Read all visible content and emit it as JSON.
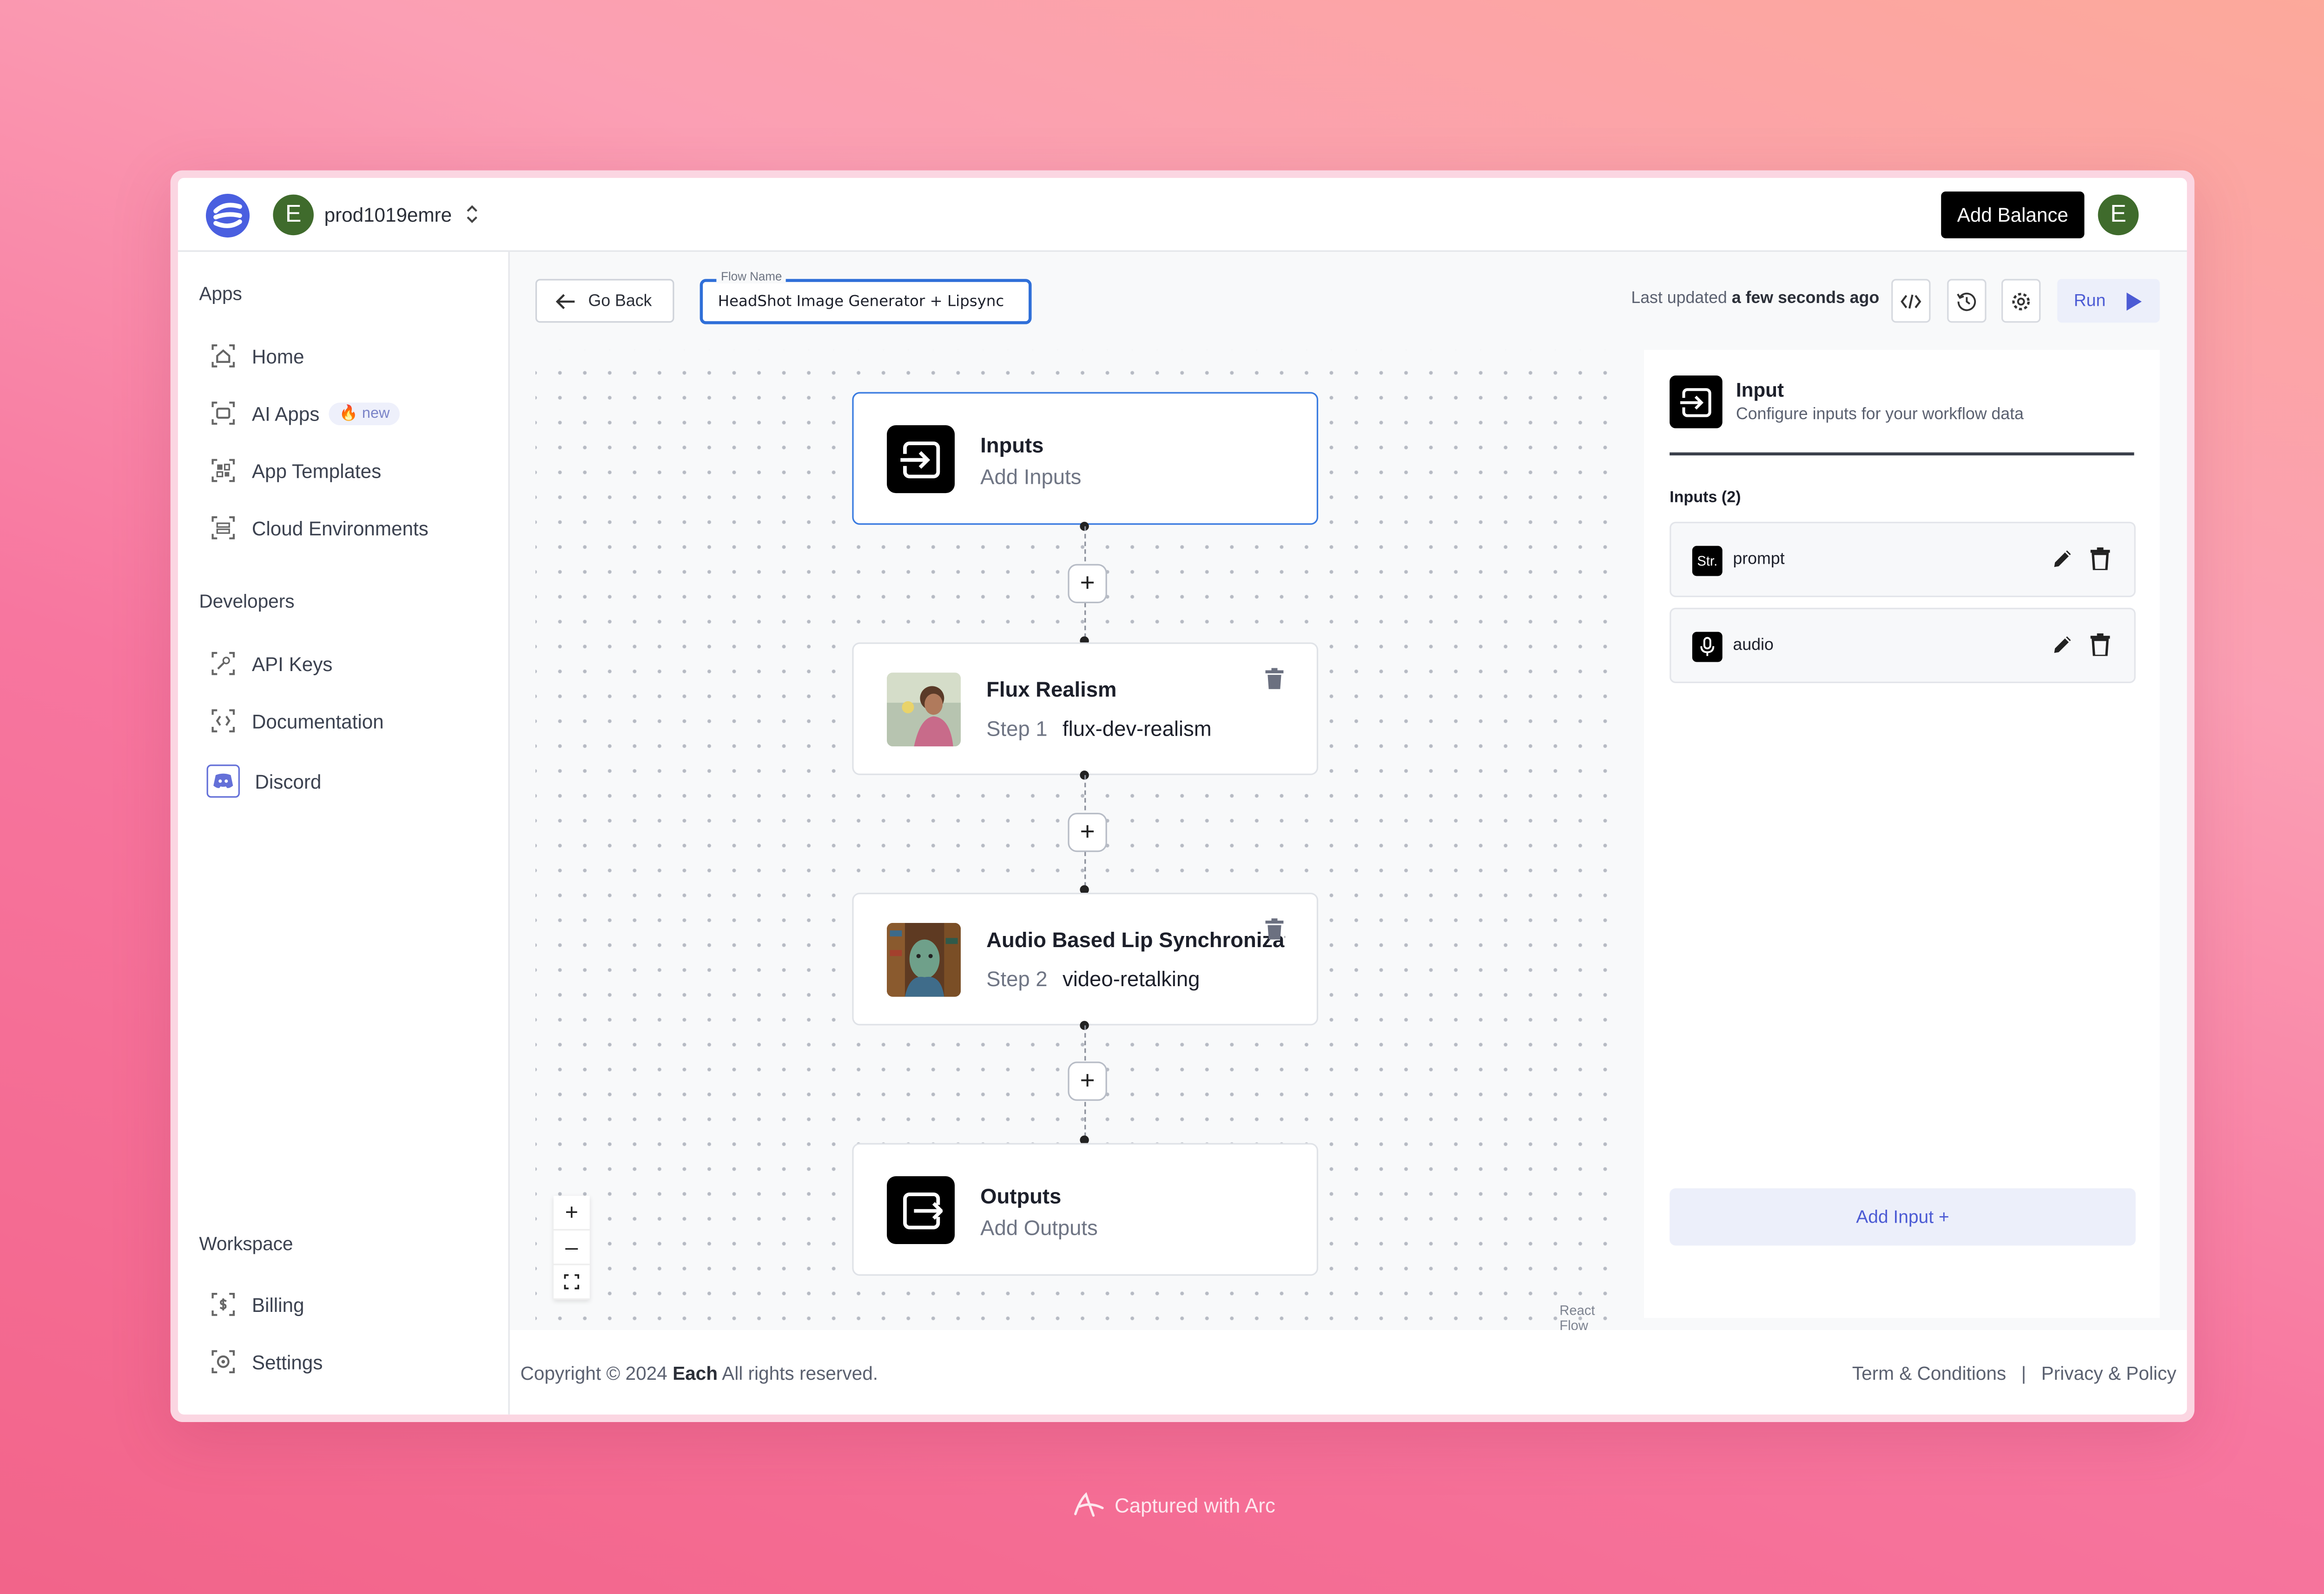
{
  "topbar": {
    "workspace_avatar": "E",
    "workspace_name": "prod1019emre",
    "add_balance_label": "Add Balance",
    "user_avatar": "E"
  },
  "sidebar": {
    "apps_title": "Apps",
    "apps": [
      {
        "label": "Home",
        "icon": "home-icon"
      },
      {
        "label": "AI Apps",
        "icon": "ai-apps-icon",
        "badge": "new"
      },
      {
        "label": "App Templates",
        "icon": "templates-icon"
      },
      {
        "label": "Cloud Environments",
        "icon": "cloud-icon"
      }
    ],
    "developers_title": "Developers",
    "developers": [
      {
        "label": "API Keys",
        "icon": "key-icon"
      },
      {
        "label": "Documentation",
        "icon": "docs-icon"
      },
      {
        "label": "Discord",
        "icon": "discord-icon"
      }
    ],
    "workspace_title": "Workspace",
    "workspace": [
      {
        "label": "Billing",
        "icon": "billing-icon"
      },
      {
        "label": "Settings",
        "icon": "gear-icon"
      }
    ]
  },
  "toolbar": {
    "go_back_label": "Go Back",
    "flow_name_label": "Flow Name",
    "flow_name_value": "HeadShot Image Generator + Lipsync",
    "updated_prefix": "Last updated",
    "updated_value": "a few seconds ago",
    "run_label": "Run"
  },
  "canvas": {
    "inputs_node": {
      "title": "Inputs",
      "subtitle": "Add Inputs"
    },
    "steps": [
      {
        "title": "Flux Realism",
        "step": "Step 1",
        "model": "flux-dev-realism"
      },
      {
        "title": "Audio Based Lip Synchronization",
        "step": "Step 2",
        "model": "video-retalking"
      }
    ],
    "outputs_node": {
      "title": "Outputs",
      "subtitle": "Add Outputs"
    },
    "attribution": "React Flow",
    "zoom_in": "+",
    "zoom_out": "–"
  },
  "panel": {
    "title": "Input",
    "description": "Configure inputs for your workflow data",
    "inputs_label": "Inputs (2)",
    "inputs": [
      {
        "name": "prompt",
        "type_icon": "Str."
      },
      {
        "name": "audio",
        "type_icon": "microphone-icon"
      }
    ],
    "add_input_label": "Add Input +"
  },
  "footer": {
    "copyright_prefix": "Copyright © 2024",
    "brand": "Each",
    "copyright_suffix": "All rights reserved.",
    "terms": "Term & Conditions",
    "separator": "|",
    "privacy": "Privacy & Policy"
  },
  "capture": {
    "label": "Captured with Arc"
  },
  "colors": {
    "accent": "#4c5bd4",
    "selected_border": "#3a7be0",
    "avatar_green": "#3f6b2c",
    "background_pink": "#f7769f"
  }
}
